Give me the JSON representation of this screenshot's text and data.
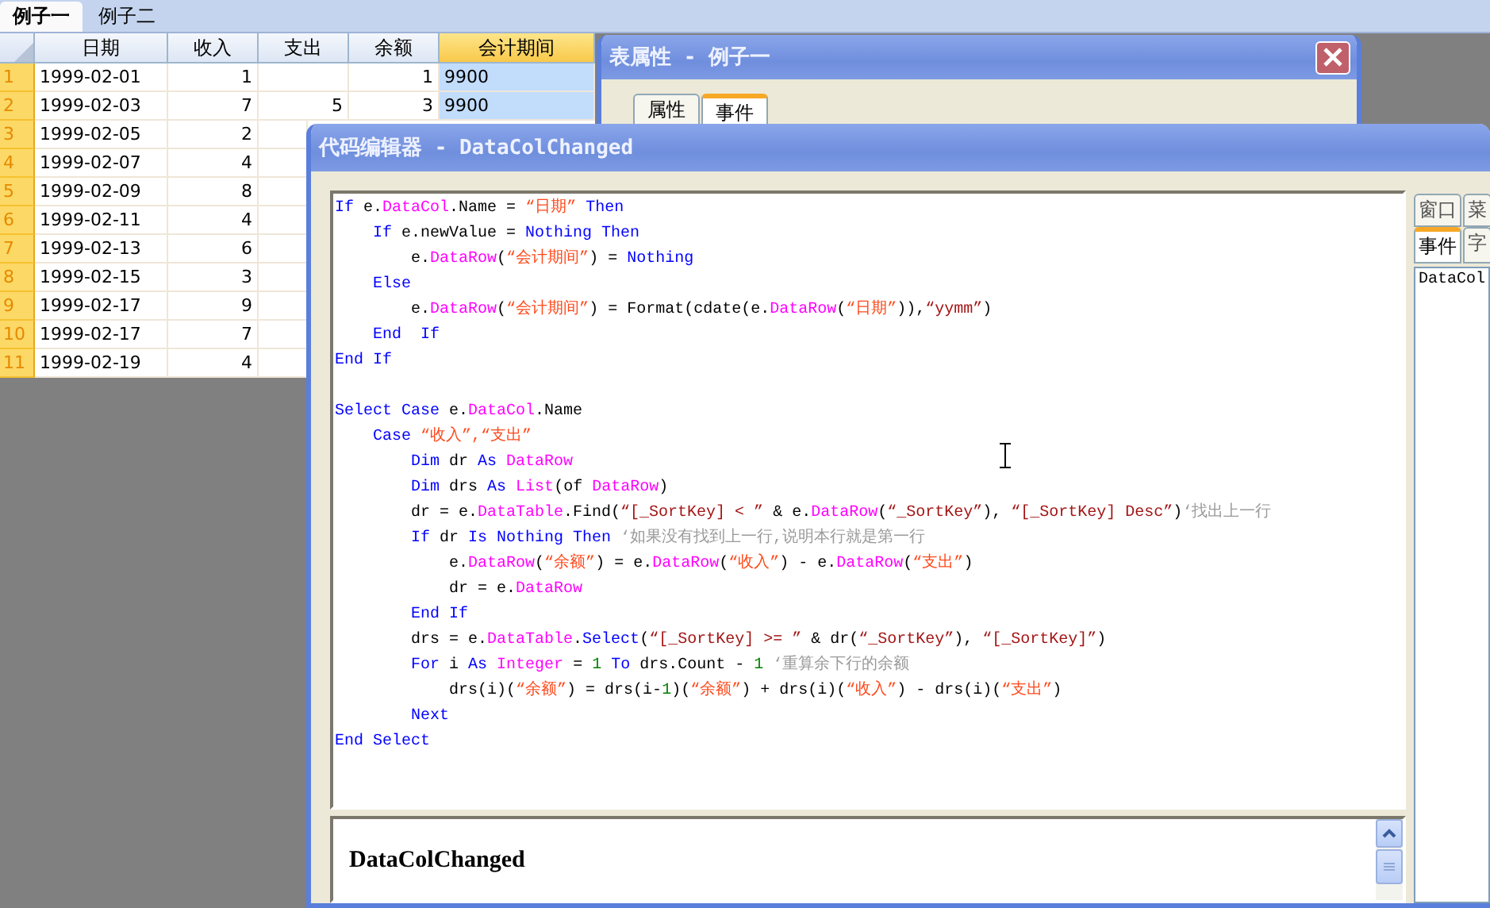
{
  "sheet_tabs": [
    {
      "label": "例子一",
      "selected": true
    },
    {
      "label": "例子二",
      "selected": false
    }
  ],
  "table": {
    "columns": [
      {
        "label": "日期",
        "kind": "text",
        "selected": false
      },
      {
        "label": "收入",
        "kind": "number",
        "selected": false
      },
      {
        "label": "支出",
        "kind": "number",
        "selected": false
      },
      {
        "label": "余额",
        "kind": "number",
        "selected": false
      },
      {
        "label": "会计期间",
        "kind": "text",
        "selected": true
      }
    ],
    "rows": [
      {
        "number": "1",
        "cells": [
          "1999-02-01",
          "1",
          "",
          "1",
          "9900"
        ]
      },
      {
        "number": "2",
        "cells": [
          "1999-02-03",
          "7",
          "5",
          "3",
          "9900"
        ]
      },
      {
        "number": "3",
        "cells": [
          "1999-02-05",
          "2"
        ]
      },
      {
        "number": "4",
        "cells": [
          "1999-02-07",
          "4"
        ]
      },
      {
        "number": "5",
        "cells": [
          "1999-02-09",
          "8"
        ]
      },
      {
        "number": "6",
        "cells": [
          "1999-02-11",
          "4"
        ]
      },
      {
        "number": "7",
        "cells": [
          "1999-02-13",
          "6"
        ]
      },
      {
        "number": "8",
        "cells": [
          "1999-02-15",
          "3"
        ]
      },
      {
        "number": "9",
        "cells": [
          "1999-02-17",
          "9"
        ]
      },
      {
        "number": "10",
        "cells": [
          "1999-02-17",
          "7"
        ]
      },
      {
        "number": "11",
        "cells": [
          "1999-02-19",
          "4"
        ]
      }
    ]
  },
  "property_window": {
    "title": "表属性 - 例子一",
    "tabs": [
      {
        "label": "属性",
        "selected": false
      },
      {
        "label": "事件",
        "selected": true
      }
    ]
  },
  "code_editor": {
    "title": "代码编辑器 - DataColChanged",
    "lines": [
      {
        "kind": "code",
        "tokens": [
          {
            "kind": "keyword",
            "text": "If"
          },
          {
            "kind": "plain",
            "text": " e."
          },
          {
            "kind": "object",
            "text": "DataCol"
          },
          {
            "kind": "plain",
            "text": ".Name = "
          },
          {
            "kind": "string",
            "text": "“日期”"
          },
          {
            "kind": "keyword",
            "text": " Then"
          }
        ]
      },
      {
        "kind": "code",
        "tokens": [
          {
            "kind": "keyword",
            "text": "    If"
          },
          {
            "kind": "plain",
            "text": " e.newValue = "
          },
          {
            "kind": "keyword",
            "text": "Nothing Then"
          }
        ]
      },
      {
        "kind": "code",
        "tokens": [
          {
            "kind": "plain",
            "text": "        e."
          },
          {
            "kind": "object",
            "text": "DataRow"
          },
          {
            "kind": "plain",
            "text": "("
          },
          {
            "kind": "string",
            "text": "“会计期间”"
          },
          {
            "kind": "plain",
            "text": ") = "
          },
          {
            "kind": "keyword",
            "text": "Nothing"
          }
        ]
      },
      {
        "kind": "code",
        "tokens": [
          {
            "kind": "keyword",
            "text": "    Else"
          }
        ]
      },
      {
        "kind": "code",
        "tokens": [
          {
            "kind": "plain",
            "text": "        e."
          },
          {
            "kind": "object",
            "text": "DataRow"
          },
          {
            "kind": "plain",
            "text": "("
          },
          {
            "kind": "string",
            "text": "“会计期间”"
          },
          {
            "kind": "plain",
            "text": ") = Format(cdate(e."
          },
          {
            "kind": "object",
            "text": "DataRow"
          },
          {
            "kind": "plain",
            "text": "("
          },
          {
            "kind": "string",
            "text": "“日期”"
          },
          {
            "kind": "plain",
            "text": ")),"
          },
          {
            "kind": "literal",
            "text": "“yymm”"
          },
          {
            "kind": "plain",
            "text": ")"
          }
        ]
      },
      {
        "kind": "code",
        "tokens": [
          {
            "kind": "keyword",
            "text": "    End  If"
          }
        ]
      },
      {
        "kind": "code",
        "tokens": [
          {
            "kind": "keyword",
            "text": "End If"
          }
        ]
      },
      {
        "kind": "blank"
      },
      {
        "kind": "code",
        "tokens": [
          {
            "kind": "keyword",
            "text": "Select Case"
          },
          {
            "kind": "plain",
            "text": " e."
          },
          {
            "kind": "object",
            "text": "DataCol"
          },
          {
            "kind": "plain",
            "text": ".Name"
          }
        ]
      },
      {
        "kind": "code",
        "tokens": [
          {
            "kind": "keyword",
            "text": "    Case"
          },
          {
            "kind": "string",
            "text": " “收入”,“支出”"
          }
        ]
      },
      {
        "kind": "code",
        "tokens": [
          {
            "kind": "keyword",
            "text": "        Dim"
          },
          {
            "kind": "plain",
            "text": " dr "
          },
          {
            "kind": "keyword",
            "text": "As"
          },
          {
            "kind": "object",
            "text": " DataRow"
          }
        ]
      },
      {
        "kind": "code",
        "tokens": [
          {
            "kind": "keyword",
            "text": "        Dim"
          },
          {
            "kind": "plain",
            "text": " drs "
          },
          {
            "kind": "keyword",
            "text": "As"
          },
          {
            "kind": "object",
            "text": " List"
          },
          {
            "kind": "plain",
            "text": "(of "
          },
          {
            "kind": "object",
            "text": "DataRow"
          },
          {
            "kind": "plain",
            "text": ")"
          }
        ]
      },
      {
        "kind": "code",
        "tokens": [
          {
            "kind": "plain",
            "text": "        dr = e."
          },
          {
            "kind": "object",
            "text": "DataTable"
          },
          {
            "kind": "plain",
            "text": ".Find("
          },
          {
            "kind": "literal",
            "text": "“[_SortKey] < ”"
          },
          {
            "kind": "plain",
            "text": " & e."
          },
          {
            "kind": "object",
            "text": "DataRow"
          },
          {
            "kind": "plain",
            "text": "("
          },
          {
            "kind": "literal",
            "text": "“_SortKey”"
          },
          {
            "kind": "plain",
            "text": "), "
          },
          {
            "kind": "literal",
            "text": "“[_SortKey] Desc”"
          },
          {
            "kind": "plain",
            "text": ")"
          },
          {
            "kind": "comment",
            "text": "‘找出上一行"
          }
        ]
      },
      {
        "kind": "code",
        "tokens": [
          {
            "kind": "keyword",
            "text": "        If"
          },
          {
            "kind": "plain",
            "text": " dr "
          },
          {
            "kind": "keyword",
            "text": "Is Nothing Then"
          },
          {
            "kind": "comment",
            "text": " ‘如果没有找到上一行,说明本行就是第一行"
          }
        ]
      },
      {
        "kind": "code",
        "tokens": [
          {
            "kind": "plain",
            "text": "            e."
          },
          {
            "kind": "object",
            "text": "DataRow"
          },
          {
            "kind": "plain",
            "text": "("
          },
          {
            "kind": "string",
            "text": "“余额”"
          },
          {
            "kind": "plain",
            "text": ") = e."
          },
          {
            "kind": "object",
            "text": "DataRow"
          },
          {
            "kind": "plain",
            "text": "("
          },
          {
            "kind": "string",
            "text": "“收入”"
          },
          {
            "kind": "plain",
            "text": ") - e."
          },
          {
            "kind": "object",
            "text": "DataRow"
          },
          {
            "kind": "plain",
            "text": "("
          },
          {
            "kind": "string",
            "text": "“支出”"
          },
          {
            "kind": "plain",
            "text": ")"
          }
        ]
      },
      {
        "kind": "code",
        "tokens": [
          {
            "kind": "plain",
            "text": "            dr = e."
          },
          {
            "kind": "object",
            "text": "DataRow"
          }
        ]
      },
      {
        "kind": "code",
        "tokens": [
          {
            "kind": "keyword",
            "text": "        End If"
          }
        ]
      },
      {
        "kind": "code",
        "tokens": [
          {
            "kind": "plain",
            "text": "        drs = e."
          },
          {
            "kind": "object",
            "text": "DataTable"
          },
          {
            "kind": "plain",
            "text": "."
          },
          {
            "kind": "keyword",
            "text": "Select"
          },
          {
            "kind": "plain",
            "text": "("
          },
          {
            "kind": "literal",
            "text": "“[_SortKey] >= ”"
          },
          {
            "kind": "plain",
            "text": " & dr("
          },
          {
            "kind": "literal",
            "text": "“_SortKey”"
          },
          {
            "kind": "plain",
            "text": "), "
          },
          {
            "kind": "literal",
            "text": "“[_SortKey]”"
          },
          {
            "kind": "plain",
            "text": ")"
          }
        ]
      },
      {
        "kind": "code",
        "tokens": [
          {
            "kind": "keyword",
            "text": "        For"
          },
          {
            "kind": "plain",
            "text": " i "
          },
          {
            "kind": "keyword",
            "text": "As"
          },
          {
            "kind": "object",
            "text": " Integer"
          },
          {
            "kind": "plain",
            "text": " = "
          },
          {
            "kind": "number",
            "text": "1"
          },
          {
            "kind": "keyword",
            "text": " To"
          },
          {
            "kind": "plain",
            "text": " drs.Count - "
          },
          {
            "kind": "number",
            "text": "1"
          },
          {
            "kind": "comment",
            "text": " ‘重算余下行的余额"
          }
        ]
      },
      {
        "kind": "code",
        "tokens": [
          {
            "kind": "plain",
            "text": "            drs(i)("
          },
          {
            "kind": "string",
            "text": "“余额”"
          },
          {
            "kind": "plain",
            "text": ") = drs(i-"
          },
          {
            "kind": "number",
            "text": "1"
          },
          {
            "kind": "plain",
            "text": ")("
          },
          {
            "kind": "string",
            "text": "“余额”"
          },
          {
            "kind": "plain",
            "text": ") + drs(i)("
          },
          {
            "kind": "string",
            "text": "“收入”"
          },
          {
            "kind": "plain",
            "text": ") - drs(i)("
          },
          {
            "kind": "string",
            "text": "“支出”"
          },
          {
            "kind": "plain",
            "text": ")"
          }
        ]
      },
      {
        "kind": "code",
        "tokens": [
          {
            "kind": "keyword",
            "text": "        Next"
          }
        ]
      },
      {
        "kind": "code",
        "tokens": [
          {
            "kind": "keyword",
            "text": "End Select"
          }
        ]
      }
    ],
    "side_tabs_top": [
      {
        "label": "窗口",
        "selected": false
      },
      {
        "label": "菜",
        "selected": false
      }
    ],
    "side_tabs_bottom": [
      {
        "label": "事件",
        "selected": true
      },
      {
        "label": "字",
        "selected": false
      }
    ],
    "side_list": [
      "DataCol"
    ],
    "help": {
      "heading": "DataColChanged"
    }
  }
}
